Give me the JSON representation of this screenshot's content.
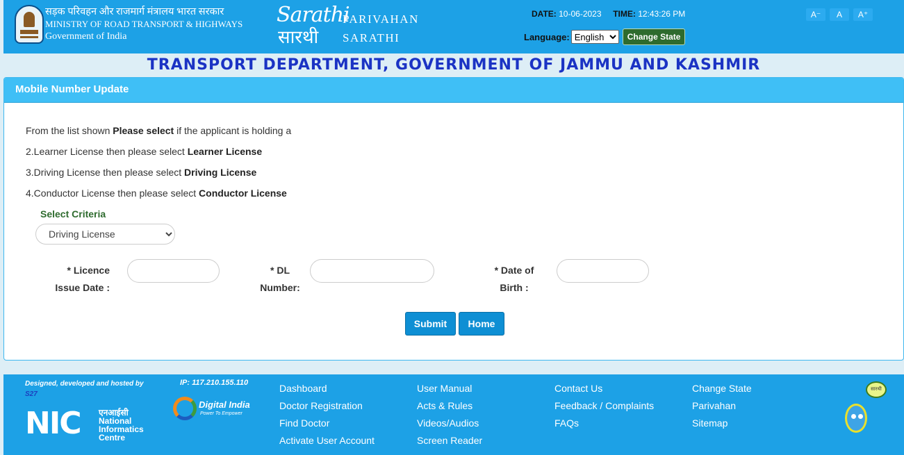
{
  "header": {
    "ministry_hindi": "सड़क परिवहन और राजमार्ग मंत्रालय भारत सरकार",
    "ministry_english": "MINISTRY OF ROAD TRANSPORT & HIGHWAYS",
    "gov": "Government of India",
    "logo_top": "Sarathi",
    "logo_bottom": "सारथी",
    "brand_line1": "PARIVAHAN",
    "brand_line2": "SARATHI",
    "date_label": "DATE:",
    "date_value": "10-06-2023",
    "time_label": "TIME:",
    "time_value": "12:43:26 PM",
    "language_label": "Language:",
    "language_value": "English",
    "change_state": "Change State",
    "font_small": "A⁻",
    "font_normal": "A",
    "font_large": "A⁺"
  },
  "page_title": "TRANSPORT DEPARTMENT, GOVERNMENT OF JAMMU AND KASHMIR",
  "panel": {
    "title": "Mobile Number Update",
    "instructions": [
      {
        "prefix": "From the list shown ",
        "bold": "Please select",
        "suffix": " if the applicant is holding a"
      },
      {
        "prefix": "2.Learner License then please select ",
        "bold": "Learner License",
        "suffix": ""
      },
      {
        "prefix": "3.Driving License then please select ",
        "bold": "Driving License",
        "suffix": ""
      },
      {
        "prefix": "4.Conductor License then please select ",
        "bold": "Conductor License",
        "suffix": ""
      }
    ],
    "criteria_label": "Select Criteria",
    "criteria_value": "Driving License",
    "fields": {
      "issue_date_line1": "* Licence",
      "issue_date_line2": "Issue Date :",
      "dl_line1": "* DL",
      "dl_line2": "Number:",
      "dob_line1": "* Date of",
      "dob_line2": "Birth :"
    },
    "submit": "Submit",
    "home": "Home"
  },
  "footer": {
    "credit_line1": "Designed, developed and hosted by",
    "credit_line2": "S27",
    "ip": "IP: 117.210.155.110",
    "nic_big": "NIC",
    "nic_hindi": "एनआईसी",
    "nic_line1": "National",
    "nic_line2": "Informatics",
    "nic_line3": "Centre",
    "digital_india": "Digital India",
    "digital_tagline": "Power To Empower",
    "mascot_text": "सारथी",
    "col1": [
      "Dashboard",
      "Doctor Registration",
      "Find Doctor",
      "Activate User Account"
    ],
    "col2": [
      "User Manual",
      "Acts & Rules",
      "Videos/Audios",
      "Screen Reader"
    ],
    "col3": [
      "Contact Us",
      "Feedback / Complaints",
      "FAQs"
    ],
    "col4": [
      "Change State",
      "Parivahan",
      "Sitemap"
    ]
  }
}
